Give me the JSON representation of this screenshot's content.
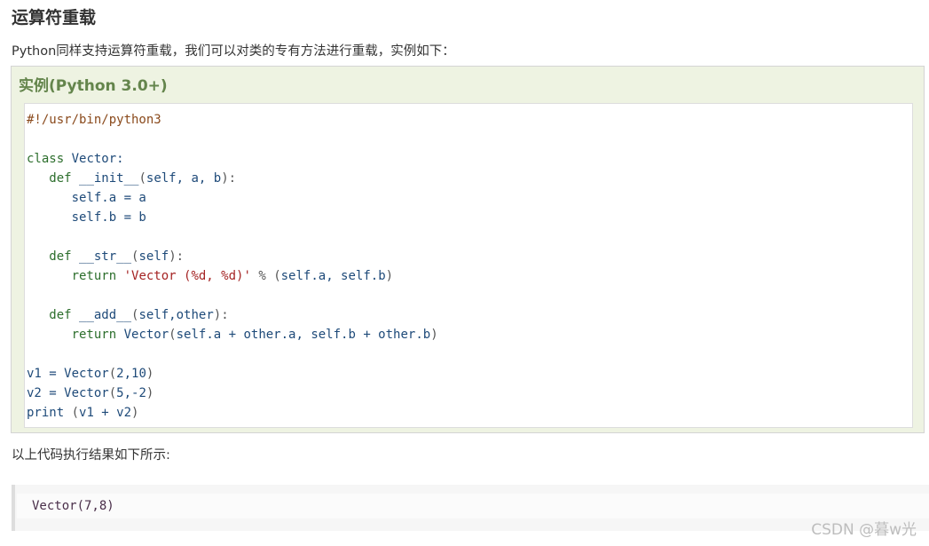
{
  "heading": "运算符重载",
  "intro": "Python同样支持运算符重载，我们可以对类的专有方法进行重载，实例如下：",
  "example": {
    "title": "实例(Python 3.0+)",
    "code_lines": [
      [
        {
          "t": "#!/usr/bin/python3",
          "c": "comment"
        }
      ],
      [],
      [
        {
          "t": "class",
          "c": "keyword"
        },
        {
          "t": " Vector:",
          "c": "plain"
        }
      ],
      [
        {
          "t": "   ",
          "c": "plain"
        },
        {
          "t": "def",
          "c": "keyword"
        },
        {
          "t": " __init__",
          "c": "plain"
        },
        {
          "t": "(",
          "c": "punct"
        },
        {
          "t": "self, a, b",
          "c": "plain"
        },
        {
          "t": "):",
          "c": "punct"
        }
      ],
      [
        {
          "t": "      self.a = a",
          "c": "plain"
        }
      ],
      [
        {
          "t": "      self.b = b",
          "c": "plain"
        }
      ],
      [],
      [
        {
          "t": "   ",
          "c": "plain"
        },
        {
          "t": "def",
          "c": "keyword"
        },
        {
          "t": " __str__",
          "c": "plain"
        },
        {
          "t": "(",
          "c": "punct"
        },
        {
          "t": "self",
          "c": "plain"
        },
        {
          "t": "):",
          "c": "punct"
        }
      ],
      [
        {
          "t": "      ",
          "c": "plain"
        },
        {
          "t": "return",
          "c": "keyword"
        },
        {
          "t": " ",
          "c": "plain"
        },
        {
          "t": "'Vector (%d, %d)'",
          "c": "string"
        },
        {
          "t": " % ",
          "c": "punct"
        },
        {
          "t": "(",
          "c": "punct"
        },
        {
          "t": "self.a, self.b",
          "c": "plain"
        },
        {
          "t": ")",
          "c": "punct"
        }
      ],
      [],
      [
        {
          "t": "   ",
          "c": "plain"
        },
        {
          "t": "def",
          "c": "keyword"
        },
        {
          "t": " __add__",
          "c": "plain"
        },
        {
          "t": "(",
          "c": "punct"
        },
        {
          "t": "self,other",
          "c": "plain"
        },
        {
          "t": "):",
          "c": "punct"
        }
      ],
      [
        {
          "t": "      ",
          "c": "plain"
        },
        {
          "t": "return",
          "c": "keyword"
        },
        {
          "t": " Vector",
          "c": "plain"
        },
        {
          "t": "(",
          "c": "punct"
        },
        {
          "t": "self.a + other.a, self.b + other.b",
          "c": "plain"
        },
        {
          "t": ")",
          "c": "punct"
        }
      ],
      [],
      [
        {
          "t": "v1 = Vector",
          "c": "plain"
        },
        {
          "t": "(",
          "c": "punct"
        },
        {
          "t": "2,10",
          "c": "plain"
        },
        {
          "t": ")",
          "c": "punct"
        }
      ],
      [
        {
          "t": "v2 = Vector",
          "c": "plain"
        },
        {
          "t": "(",
          "c": "punct"
        },
        {
          "t": "5,-2",
          "c": "plain"
        },
        {
          "t": ")",
          "c": "punct"
        }
      ],
      [
        {
          "t": "print",
          "c": "plain"
        },
        {
          "t": " (",
          "c": "punct"
        },
        {
          "t": "v1 + v2",
          "c": "plain"
        },
        {
          "t": ")",
          "c": "punct"
        }
      ]
    ]
  },
  "result_label": "以上代码执行结果如下所示:",
  "output": "Vector(7,8)",
  "watermark": "CSDN @暮w光",
  "colors": {
    "example_title": "#64854c",
    "example_bg": "#eef3e2",
    "comment": "#8a4a1c",
    "keyword": "#2c6e2c",
    "string": "#a52424",
    "plain": "#1e4a79"
  }
}
